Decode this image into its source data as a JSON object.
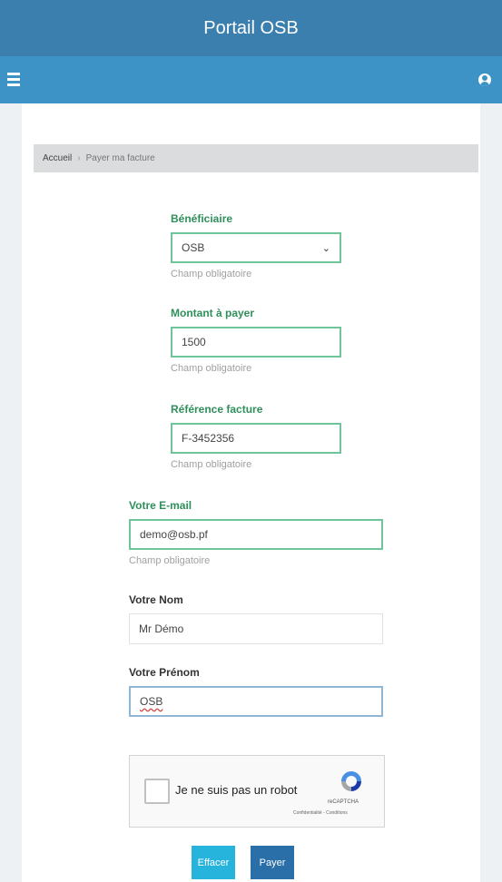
{
  "header": {
    "title": "Portail OSB"
  },
  "breadcrumb": {
    "home": "Accueil",
    "separator": "›",
    "current": "Payer ma facture"
  },
  "form": {
    "beneficiary": {
      "label": "Bénéficiaire",
      "value": "OSB",
      "help": "Champ obligatoire"
    },
    "amount": {
      "label": "Montant à payer",
      "value": "1500",
      "help": "Champ obligatoire"
    },
    "invoice_ref": {
      "label": "Référence facture",
      "value": "F-3452356",
      "help": "Champ obligatoire"
    },
    "email": {
      "label": "Votre E-mail",
      "value": "demo@osb.pf",
      "help": "Champ obligatoire"
    },
    "last_name": {
      "label": "Votre Nom",
      "value": "Mr Démo"
    },
    "first_name": {
      "label": "Votre Prénom",
      "value": "OSB"
    }
  },
  "captcha": {
    "text": "Je ne suis pas un robot",
    "brand": "reCAPTCHA",
    "legal": "Confidentialité - Conditions"
  },
  "buttons": {
    "clear": "Effacer",
    "pay": "Payer"
  },
  "colors": {
    "topbar": "#3b7fae",
    "navbar": "#3d93c6",
    "label_green": "#2f8f5b",
    "input_border_green": "#6fc49a",
    "clear_button": "#27b4dc",
    "pay_button": "#2a6fa7"
  },
  "icons": {
    "menu": "hamburger-menu-icon",
    "user": "user-circle-icon",
    "select": "chevron-down-icon",
    "captcha": "recaptcha-logo-icon"
  }
}
